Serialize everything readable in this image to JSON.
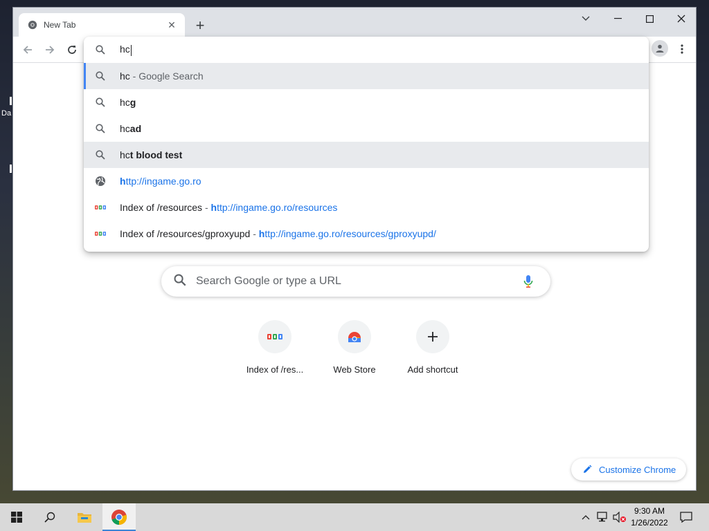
{
  "desktop": {
    "icon_label": "Da"
  },
  "browser": {
    "tab": {
      "title": "New Tab",
      "close_symbol": "✕"
    },
    "new_tab_symbol": "+",
    "window_controls": {
      "dropdown": "⌄",
      "minimize": "—",
      "maximize": "☐",
      "close": "✕"
    },
    "omnibox": {
      "typed_text": "hc",
      "suggestions": [
        {
          "icon": "search-icon",
          "parts": [
            {
              "t": "hc",
              "b": false
            }
          ],
          "sep": " - ",
          "desc": "Google Search",
          "state": "selected"
        },
        {
          "icon": "search-icon",
          "parts": [
            {
              "t": "hc",
              "b": false
            },
            {
              "t": "g",
              "b": true
            }
          ]
        },
        {
          "icon": "search-icon",
          "parts": [
            {
              "t": "hc",
              "b": false
            },
            {
              "t": "ad",
              "b": true
            }
          ]
        },
        {
          "icon": "search-icon",
          "parts": [
            {
              "t": "hc",
              "b": false
            },
            {
              "t": "t blood test",
              "b": true
            }
          ],
          "state": "hover"
        },
        {
          "icon": "globe-icon",
          "url_bold": "h",
          "url_rest": "ttp://ingame.go.ro"
        },
        {
          "icon": "site-favicon-icon",
          "title": "Index of /resources",
          "sep": " - ",
          "url_bold": "h",
          "url_rest": "ttp://ingame.go.ro/resources"
        },
        {
          "icon": "site-favicon-icon",
          "title": "Index of /resources/gproxyupd",
          "sep": " - ",
          "url_bold": "h",
          "url_rest": "ttp://ingame.go.ro/resources/gproxyupd/"
        }
      ]
    },
    "ntp": {
      "search_placeholder": "Search Google or type a URL",
      "shortcuts": [
        {
          "label": "Index of /res...",
          "icon": "site-favicon-icon"
        },
        {
          "label": "Web Store",
          "icon": "web-store-icon"
        },
        {
          "label": "Add shortcut",
          "icon": "plus-icon",
          "symbol": "+"
        }
      ],
      "customize_label": "Customize Chrome"
    }
  },
  "taskbar": {
    "clock": {
      "time": "9:30 AM",
      "date": "1/26/2022"
    }
  },
  "colors": {
    "accent": "#1a73e8",
    "selection_bar": "#4285f4",
    "taskbar": "#d9d9d9"
  }
}
